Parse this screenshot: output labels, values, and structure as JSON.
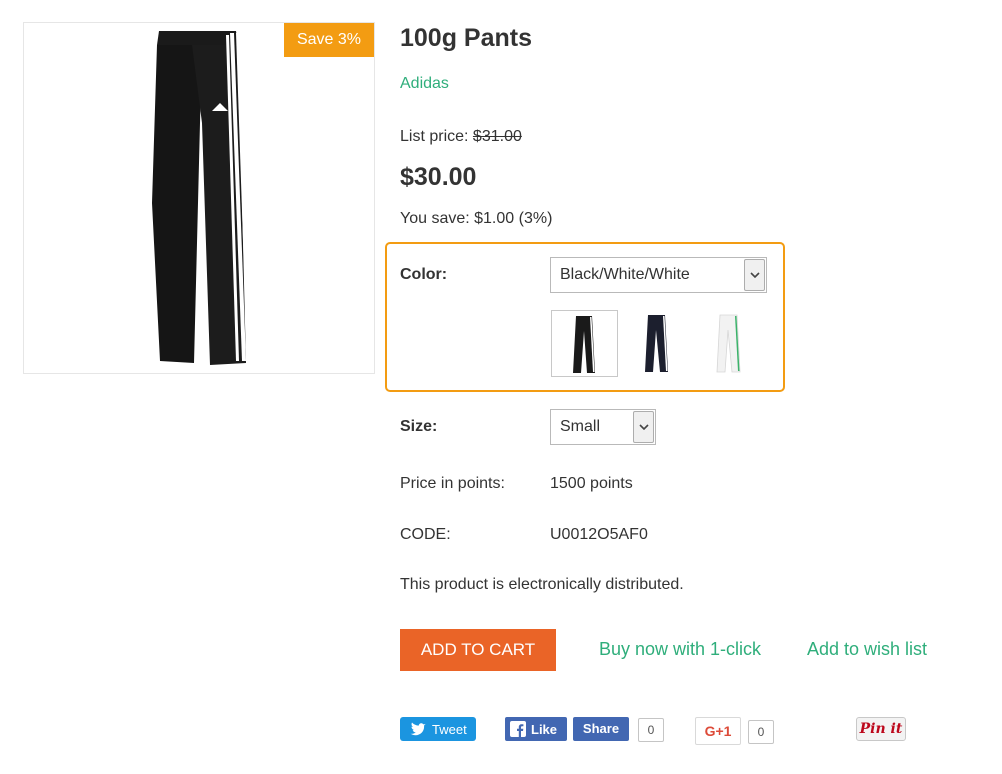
{
  "product": {
    "title": "100g Pants",
    "brand": "Adidas",
    "save_badge": "Save 3%",
    "list_price_label": "List price:",
    "list_price_value": "$31.00",
    "price": "$30.00",
    "you_save": "You save: $1.00 (3%)"
  },
  "options": {
    "color_label": "Color:",
    "color_selected": "Black/White/White",
    "color_variants": [
      "black-pants-thumbnail",
      "navy-pants-thumbnail",
      "white-pants-thumbnail"
    ],
    "size_label": "Size:",
    "size_selected": "Small"
  },
  "details": {
    "points_label": "Price in points:",
    "points_value": "1500 points",
    "code_label": "CODE:",
    "code_value": "U0012O5AF0",
    "distribution_note": "This product is electronically distributed."
  },
  "actions": {
    "add_to_cart": "ADD TO CART",
    "buy_now": "Buy now with 1-click",
    "wishlist": "Add to wish list"
  },
  "social": {
    "tweet": "Tweet",
    "like": "Like",
    "share": "Share",
    "fb_count": "0",
    "gplus": "G+1",
    "gplus_count": "0",
    "pinit": "Pin it"
  },
  "colors": {
    "accent_orange": "#f39c12",
    "cart_orange": "#ea6427",
    "link_green": "#2fae7b",
    "twitter_blue": "#1b95e0",
    "facebook_blue": "#4267b2"
  }
}
